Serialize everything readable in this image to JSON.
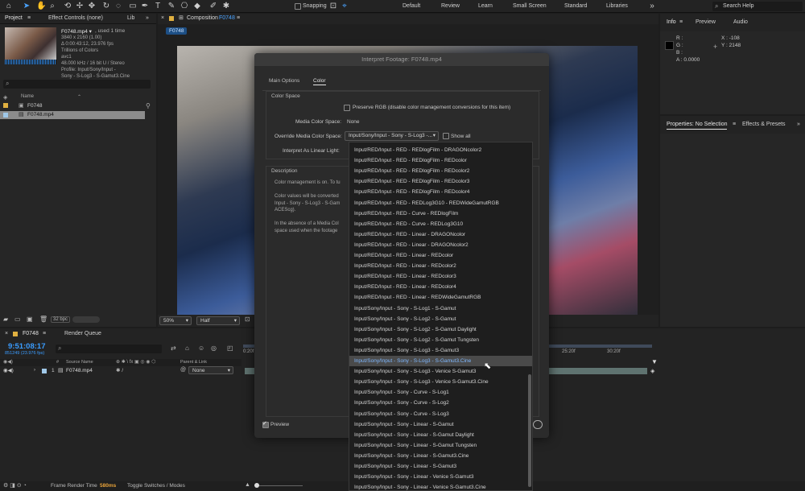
{
  "toolbar": {
    "snapping": "Snapping",
    "workspaces": [
      "Default",
      "Review",
      "Learn",
      "Small Screen",
      "Standard",
      "Libraries"
    ],
    "search_help": "Search Help"
  },
  "project": {
    "tabs": {
      "project": "Project",
      "effect_controls": "Effect Controls (none)",
      "lib": "Lib"
    },
    "file": {
      "name": "F0748.mp4 ▾",
      "used": ", used 1 time",
      "lines": [
        "3840 x 2160 (1.00)",
        "Δ 0:00:43:12, 23.976 fps",
        "Trillions of Colors",
        "avc1",
        "48.000 kHz / 16 bit U / Stereo",
        "Profile: Input/Sony/Input -",
        "Sony - S-Log3 - S-Gamut3.Cine"
      ]
    },
    "search_placeholder": "⌕",
    "name_header": "Name",
    "items": [
      "F0748",
      "F0748.mp4"
    ],
    "bpc": "32 bpc"
  },
  "composition": {
    "tab": "Composition",
    "tab_name": "F0748",
    "comp_pill": "F0748",
    "zoom": "50%",
    "resolution": "Half"
  },
  "info": {
    "tabs": [
      "Info",
      "Preview",
      "Audio"
    ],
    "rgba_labels": [
      "R :",
      "G :",
      "B :",
      "A :"
    ],
    "alpha_value": "0.0000",
    "x": "X : -108",
    "y": "Y : 2148"
  },
  "properties": {
    "title": "Properties: No Selection",
    "effects": "Effects & Presets"
  },
  "timeline": {
    "tab": "F0748",
    "render_queue": "Render Queue",
    "timecode": "9:51:08:17",
    "frame_info": "851249 (23.976 fps)",
    "search_placeholder": "⌕",
    "col_source": "Source Name",
    "col_parent": "Parent & Link",
    "layer_num": "1",
    "layer_name": "F0748.mp4",
    "parent_value": "None",
    "ruler": [
      "0:20f",
      "25:20f",
      "30:20f"
    ],
    "frame_render_label": "Frame Render Time",
    "frame_render_value": "580ms",
    "toggle_label": "Toggle Switches / Modes"
  },
  "dialog": {
    "title": "Interpret Footage: F0748.mp4",
    "tabs": [
      "Main Options",
      "Color"
    ],
    "active_tab": 1,
    "color_space_section": "Color Space",
    "preserve_rgb": "Preserve RGB (disable color management conversions for this item)",
    "media_color_space_label": "Media Color Space:",
    "media_color_space_value": "None",
    "override_label": "Override Media Color Space:",
    "override_value": "Input/Sony/Input - Sony - S-Log3 -...",
    "show_all": "Show all",
    "linear_label": "Interpret As Linear Light:",
    "description_section": "Description",
    "description_lines": [
      "Color management is on. To tu",
      "",
      "Color values will be converted",
      "Input - Sony - S-Log3 - S-Gam",
      "ACEScg).",
      "",
      "In the absence of a Media Col",
      "space used when the footage"
    ],
    "preview": "Preview"
  },
  "dropdown": {
    "selected_index": 19,
    "options": [
      "Input/RED/Input - RED - REDlogFilm - DRAGONcolor2",
      "Input/RED/Input - RED - REDlogFilm - REDcolor",
      "Input/RED/Input - RED - REDlogFilm - REDcolor2",
      "Input/RED/Input - RED - REDlogFilm - REDcolor3",
      "Input/RED/Input - RED - REDlogFilm - REDcolor4",
      "Input/RED/Input - RED - REDLog3G10 - REDWideGamutRGB",
      "Input/RED/Input - RED - Curve - REDlogFilm",
      "Input/RED/Input - RED - Curve - REDLog3G10",
      "Input/RED/Input - RED - Linear - DRAGONcolor",
      "Input/RED/Input - RED - Linear - DRAGONcolor2",
      "Input/RED/Input - RED - Linear - REDcolor",
      "Input/RED/Input - RED - Linear - REDcolor2",
      "Input/RED/Input - RED - Linear - REDcolor3",
      "Input/RED/Input - RED - Linear - REDcolor4",
      "Input/RED/Input - RED - Linear - REDWideGamutRGB",
      "Input/Sony/Input - Sony - S-Log1 - S-Gamut",
      "Input/Sony/Input - Sony - S-Log2 - S-Gamut",
      "Input/Sony/Input - Sony - S-Log2 - S-Gamut Daylight",
      "Input/Sony/Input - Sony - S-Log2 - S-Gamut Tungsten",
      "Input/Sony/Input - Sony - S-Log3 - S-Gamut3",
      "Input/Sony/Input - Sony - S-Log3 - S-Gamut3.Cine",
      "Input/Sony/Input - Sony - S-Log3 - Venice S-Gamut3",
      "Input/Sony/Input - Sony - S-Log3 - Venice S-Gamut3.Cine",
      "Input/Sony/Input - Sony - Curve - S-Log1",
      "Input/Sony/Input - Sony - Curve - S-Log2",
      "Input/Sony/Input - Sony - Curve - S-Log3",
      "Input/Sony/Input - Sony - Linear - S-Gamut",
      "Input/Sony/Input - Sony - Linear - S-Gamut Daylight",
      "Input/Sony/Input - Sony - Linear - S-Gamut Tungsten",
      "Input/Sony/Input - Sony - Linear - S-Gamut3.Cine",
      "Input/Sony/Input - Sony - Linear - S-Gamut3",
      "Input/Sony/Input - Sony - Linear - Venice S-Gamut3",
      "Input/Sony/Input - Sony - Linear - Venice S-Gamut3.Cine"
    ]
  },
  "colors": {
    "accent_blue": "#2d8ceb",
    "timecode_blue": "#3a9cff",
    "selected_text": "#7fb8ff",
    "render_time_orange": "#e8a33a"
  }
}
